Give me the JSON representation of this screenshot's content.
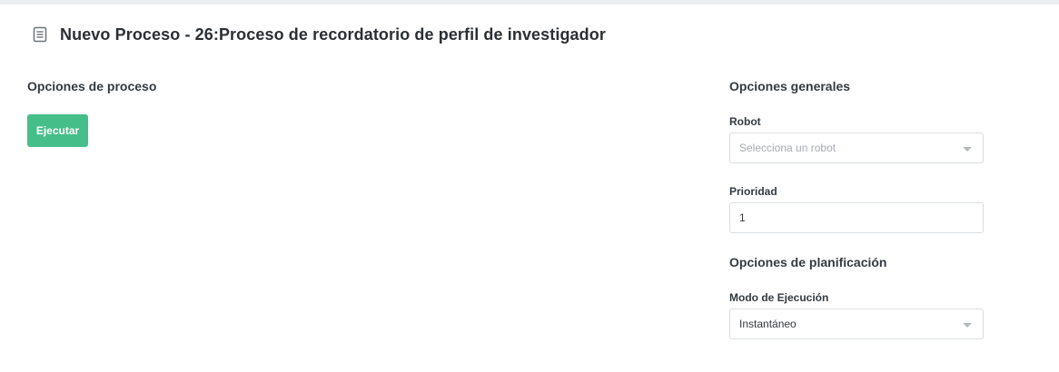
{
  "header": {
    "title": "Nuevo Proceso - 26:Proceso de recordatorio de perfil de investigador",
    "icon": "document-icon"
  },
  "left": {
    "section_title": "Opciones de proceso",
    "run_button": "Ejecutar"
  },
  "right": {
    "general_title": "Opciones generales",
    "robot_label": "Robot",
    "robot_placeholder": "Selecciona un robot",
    "priority_label": "Prioridad",
    "priority_value": "1",
    "planning_title": "Opciones de planificación",
    "mode_label": "Modo de Ejecución",
    "mode_value": "Instantáneo"
  },
  "colors": {
    "accent": "#46be8a",
    "border": "#d9dde1"
  }
}
